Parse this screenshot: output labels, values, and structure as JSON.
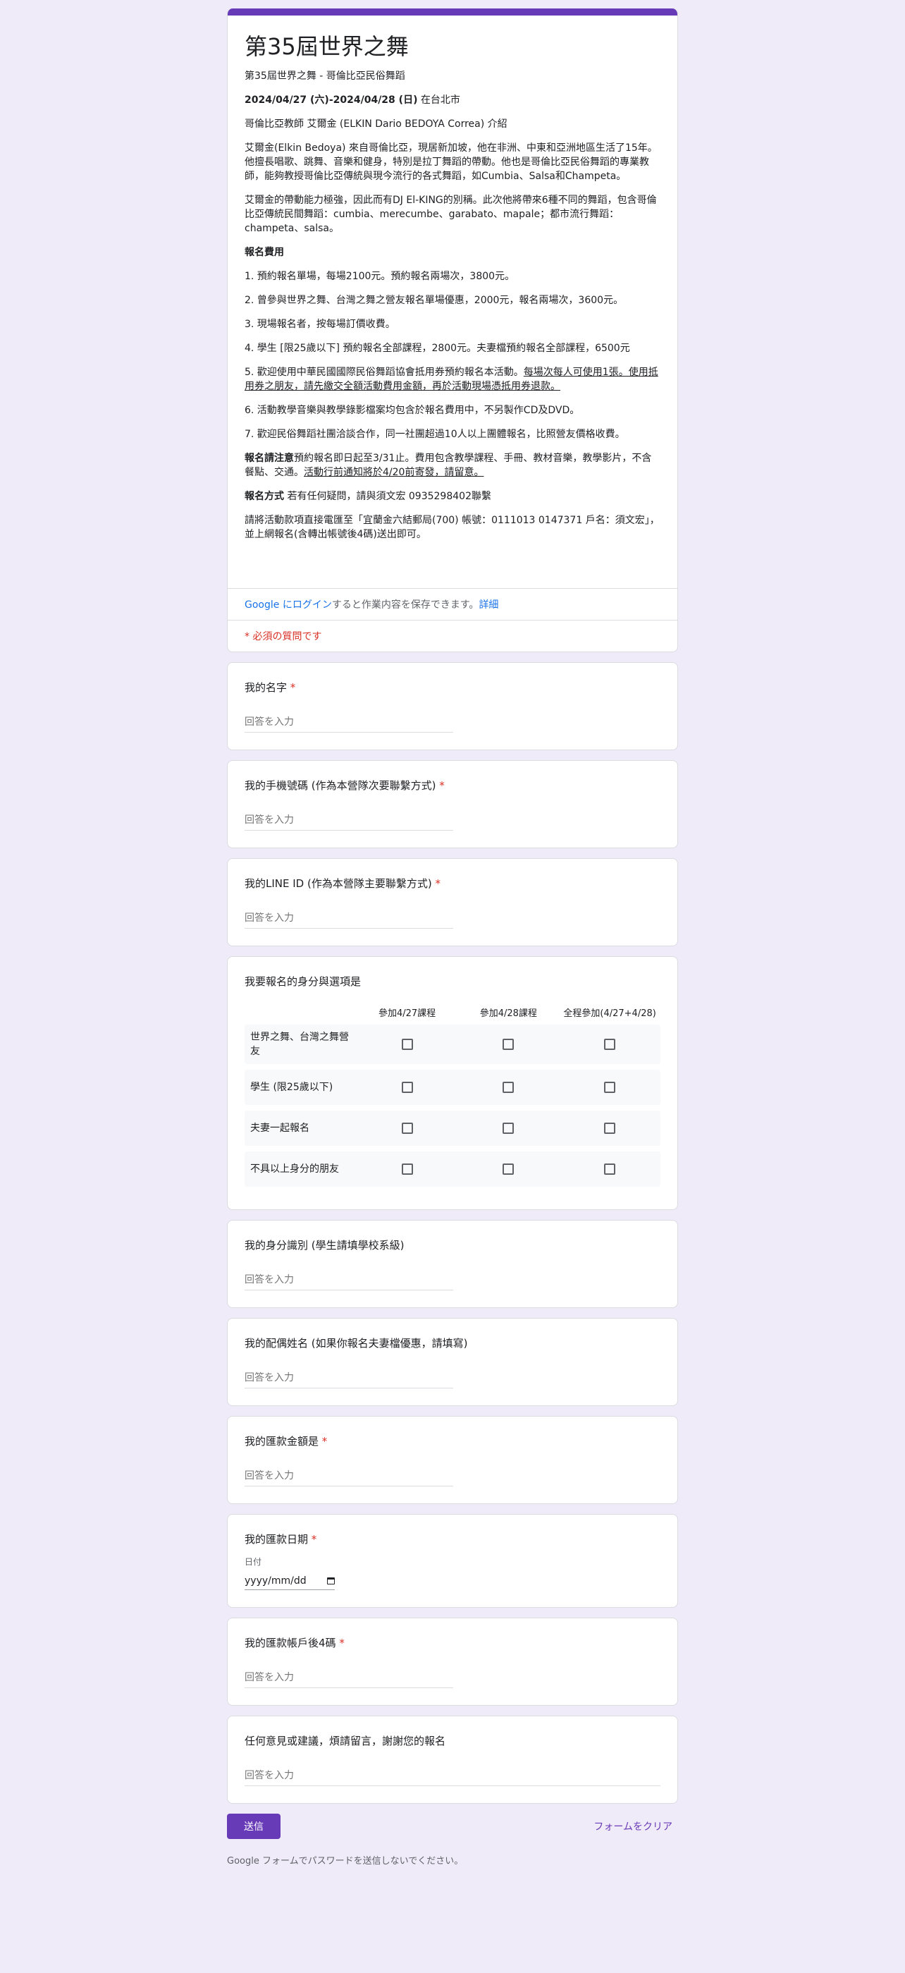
{
  "header": {
    "title": "第35屆世界之舞",
    "subtitle": "第35屆世界之舞 - 哥倫比亞民俗舞蹈",
    "dates_bold": "2024/04/27 (六)-2024/04/28 (日)",
    "dates_tail": " 在台北市",
    "teacher": "哥倫比亞教師  艾爾金 (ELKIN Dario BEDOYA Correa)  介紹",
    "intro1": "艾爾金(Elkin Bedoya) 來自哥倫比亞，現居新加坡，他在非洲、中東和亞洲地區生活了15年。他擅長唱歌、跳舞、音樂和健身，特別是拉丁舞蹈的帶動。他也是哥倫比亞民俗舞蹈的專業教師，能夠教授哥倫比亞傳統與現今流行的各式舞蹈，如Cumbia、Salsa和Champeta。",
    "intro2": "艾爾金的帶動能力極強，因此而有DJ El-KING的別稱。此次他將帶來6種不同的舞蹈，包含哥倫比亞傳統民間舞蹈：cumbia、merecumbe、garabato、mapale；都市流行舞蹈：champeta、salsa。",
    "fee_heading": "報名費用",
    "fee1": "1. 預約報名單場，每場2100元。預約報名兩場次，3800元。",
    "fee2": "2. 曾參與世界之舞、台灣之舞之營友報名單場優惠，2000元，報名兩場次，3600元。",
    "fee3": "3. 現場報名者，按每場訂價收費。",
    "fee4": "4.  學生 [限25歲以下] 預約報名全部課程，2800元。夫妻檔預約報名全部課程，6500元",
    "fee5_a": "5. 歡迎使用中華民國國際民俗舞蹈協會抵用券預約報名本活動。",
    "fee5_b": "每場次每人可使用1張。使用抵用券之朋友，請先繳交全額活動費用金額，再於活動現場憑抵用券退款。",
    "fee6": "6.  活動教學音樂與教學錄影檔案均包含於報名費用中，不另製作CD及DVD。",
    "fee7": "7.  歡迎民俗舞蹈社團洽談合作，同一社團超過10人以上團體報名，比照營友價格收費。",
    "notice_head": "報名請注意",
    "notice_a": "預約報名即日起至3/31止。費用包含教學課程、手冊、教材音樂，教學影片，不含餐點、交通。",
    "notice_b": "活動行前通知將於4/20前寄發，請留意。",
    "method_head": "報名方式",
    "method_text": "  若有任何疑問，請與須文宏 0935298402聯繫",
    "bank": "請將活動款項直接電匯至「宜蘭金六結郵局(700) 帳號：0111013 0147371 戶名：須文宏」，並上網報名(含轉出帳號後4碼)送出即可。",
    "login_link": "Google にログイン",
    "login_text": "すると作業内容を保存できます。",
    "login_more": "詳細",
    "required_note": "* 必須の質問です"
  },
  "questions": {
    "name": {
      "label": "我的名字",
      "placeholder": "回答を入力"
    },
    "phone": {
      "label": "我的手機號碼 (作為本營隊次要聯繫方式)",
      "placeholder": "回答を入力"
    },
    "line": {
      "label": "我的LINE ID (作為本營隊主要聯繫方式)",
      "placeholder": "回答を入力"
    },
    "grid": {
      "label": "我要報名的身分與選項是",
      "columns": [
        "參加4/27課程",
        "參加4/28課程",
        "全程參加(4/27+4/28)"
      ],
      "rows": [
        "世界之舞、台灣之舞營友",
        "學生 (限25歲以下)",
        "夫妻一起報名",
        "不具以上身分的朋友"
      ]
    },
    "identity": {
      "label": "我的身分識別 (學生請填學校系級)",
      "placeholder": "回答を入力"
    },
    "spouse": {
      "label": "我的配偶姓名 (如果你報名夫妻檔優惠，請填寫)",
      "placeholder": "回答を入力"
    },
    "amount": {
      "label": "我的匯款金額是",
      "placeholder": "回答を入力"
    },
    "date": {
      "label": "我的匯款日期",
      "sublabel": "日付",
      "value": "yyyy/mm/dd"
    },
    "account": {
      "label": "我的匯款帳戶後4碼",
      "placeholder": "回答を入力"
    },
    "comments": {
      "label": "任何意見或建議，煩請留言，謝謝您的報名",
      "placeholder": "回答を入力"
    }
  },
  "required_mark": "*",
  "footer": {
    "submit": "送信",
    "clear": "フォームをクリア",
    "note": "Google フォームでパスワードを送信しないでください。"
  }
}
